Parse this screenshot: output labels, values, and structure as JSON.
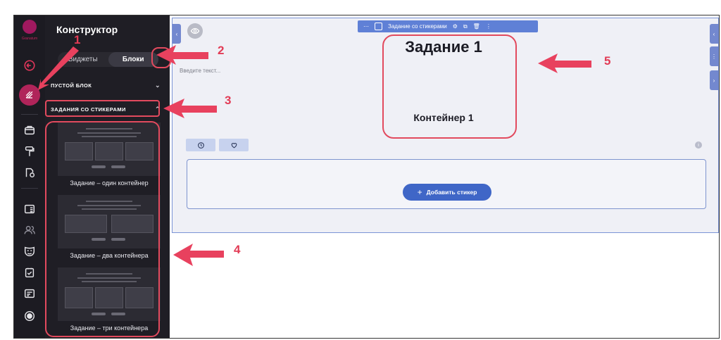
{
  "rail": {
    "logo_text": "Granatum",
    "icons": [
      "back-icon",
      "constructor-icon",
      "blocks-icon",
      "paint-roller-icon",
      "settings-doc-icon",
      "list-icon",
      "users-icon",
      "mask-icon",
      "checklist-icon",
      "id-card-icon",
      "record-icon"
    ]
  },
  "panel": {
    "title": "Конструктор",
    "tabs": [
      {
        "label": "Виджеты"
      },
      {
        "label": "Блоки",
        "active": true
      }
    ],
    "sections": [
      {
        "label": "ПУСТОЙ БЛОК",
        "expanded": false
      },
      {
        "label": "ЗАДАНИЯ СО СТИКЕРАМИ",
        "expanded": true
      }
    ],
    "cards": [
      {
        "label": "Задание – один контейнер"
      },
      {
        "label": "Задание – два контейнера"
      },
      {
        "label": "Задание – три контейнера"
      }
    ]
  },
  "canvas": {
    "toolbar_label": "Задание со стикерами",
    "placeholder": "Введите текст...",
    "task_title": "Задание 1",
    "container_title": "Контейнер 1",
    "add_sticker_label": "Добавить стикер"
  },
  "annotations": [
    "1",
    "2",
    "3",
    "4",
    "5"
  ],
  "colors": {
    "accent": "#e24a5e",
    "toolbar": "#5f80d6",
    "button": "#3f66c7",
    "active_icon": "#b0245a"
  }
}
